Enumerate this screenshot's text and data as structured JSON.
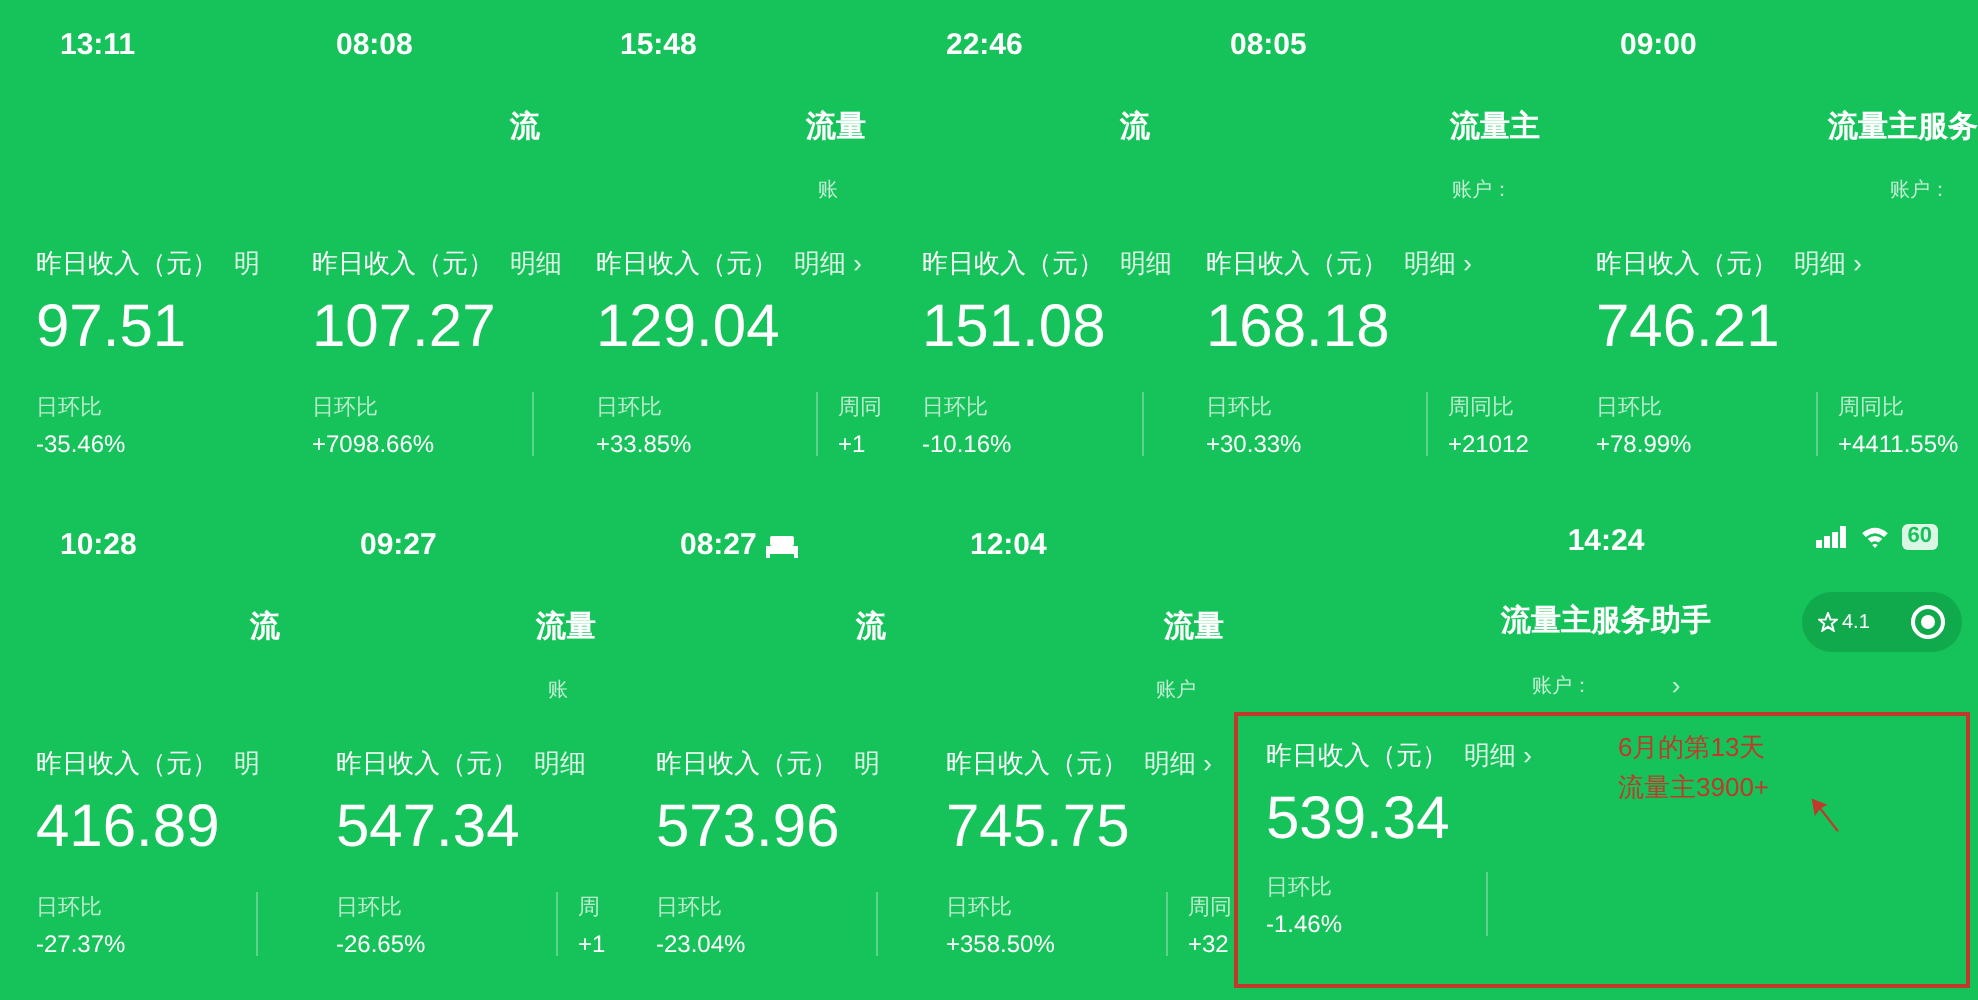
{
  "rows": [
    {
      "panels": [
        {
          "time": "13:11",
          "label": "昨日收入（元）",
          "detail": "明",
          "amount": "97.51",
          "stats": [
            {
              "label": "日环比",
              "value": "-35.46%"
            }
          ],
          "divider": false
        },
        {
          "time": "08:08",
          "title": "流",
          "label": "昨日收入（元）",
          "detail": "明细",
          "amount": "107.27",
          "stats": [
            {
              "label": "日环比",
              "value": "+7098.66%"
            }
          ],
          "divider": true
        },
        {
          "time": "15:48",
          "title": "流量",
          "account": "账",
          "label": "昨日收入（元）",
          "detail": "明细 ›",
          "amount": "129.04",
          "stats": [
            {
              "label": "日环比",
              "value": "+33.85%"
            },
            {
              "label": "周同",
              "value": "+1"
            }
          ],
          "divider": true
        },
        {
          "time": "22:46",
          "title": "流",
          "label": "昨日收入（元）",
          "detail": "明细",
          "amount": "151.08",
          "stats": [
            {
              "label": "日环比",
              "value": "-10.16%"
            }
          ],
          "divider": true
        },
        {
          "time": "08:05",
          "title": "流量主",
          "account": "账户：",
          "label": "昨日收入（元）",
          "detail": "明细 ›",
          "amount": "168.18",
          "stats": [
            {
              "label": "日环比",
              "value": "+30.33%"
            },
            {
              "label": "周同比",
              "value": "+21012"
            }
          ],
          "divider": true
        },
        {
          "time": "09:00",
          "title": "流量主服务",
          "account": "账户：",
          "label": "昨日收入（元）",
          "detail": "明细 ›",
          "amount": "746.21",
          "stats": [
            {
              "label": "日环比",
              "value": "+78.99%"
            },
            {
              "label": "周同比",
              "value": "+4411.55%"
            }
          ],
          "divider": true
        }
      ]
    },
    {
      "panels": [
        {
          "time": "10:28",
          "title": "流",
          "label": "昨日收入（元）",
          "detail": "明",
          "amount": "416.89",
          "stats": [
            {
              "label": "日环比",
              "value": "-27.37%"
            }
          ],
          "divider": true
        },
        {
          "time": "09:27",
          "title": "流量",
          "account": "账",
          "label": "昨日收入（元）",
          "detail": "明细",
          "amount": "547.34",
          "stats": [
            {
              "label": "日环比",
              "value": "-26.65%"
            },
            {
              "label": "周",
              "value": "+1"
            }
          ],
          "divider": true
        },
        {
          "time": "08:27",
          "sleep_focus": true,
          "title": "流",
          "label": "昨日收入（元）",
          "detail": "明",
          "amount": "573.96",
          "stats": [
            {
              "label": "日环比",
              "value": "-23.04%"
            }
          ],
          "divider": true
        },
        {
          "time": "12:04",
          "title": "流量",
          "account": "账户",
          "label": "昨日收入（元）",
          "detail": "明细 ›",
          "amount": "745.75",
          "stats": [
            {
              "label": "日环比",
              "value": "+358.50%"
            },
            {
              "label": "周同",
              "value": "+32"
            }
          ],
          "divider": true
        },
        {
          "time": "14:24",
          "battery": "60",
          "title": "流量主服务助手",
          "rating": "4.1",
          "account": "账户：",
          "account_arrow": "›",
          "highlighted": true,
          "label": "昨日收入（元）",
          "detail": "明细 ›",
          "amount": "539.34",
          "stats": [
            {
              "label": "日环比",
              "value": "-1.46%"
            }
          ],
          "divider": true,
          "note": [
            "6月的第13天",
            "流量主3900+"
          ]
        }
      ]
    }
  ]
}
